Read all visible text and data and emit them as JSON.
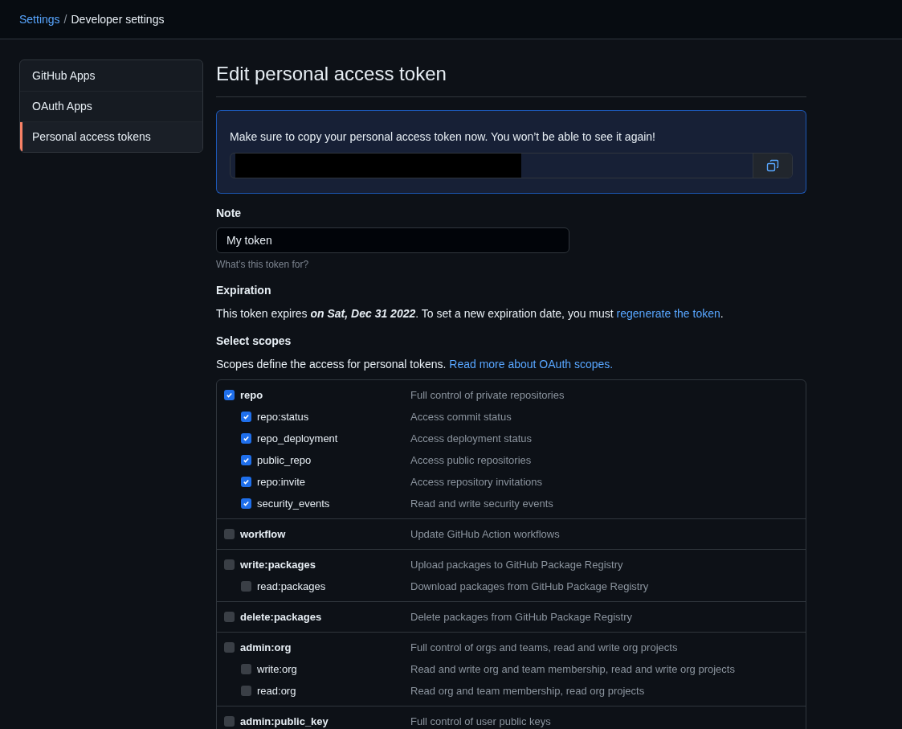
{
  "breadcrumb": {
    "link": "Settings",
    "separator": "/",
    "current": "Developer settings"
  },
  "sidebar": {
    "items": [
      {
        "label": "GitHub Apps",
        "selected": false
      },
      {
        "label": "OAuth Apps",
        "selected": false
      },
      {
        "label": "Personal access tokens",
        "selected": true
      }
    ]
  },
  "title": "Edit personal access token",
  "flash": {
    "message": "Make sure to copy your personal access token now. You won’t be able to see it again!"
  },
  "note": {
    "label": "Note",
    "value": "My token",
    "hint": "What’s this token for?"
  },
  "expiration": {
    "label": "Expiration",
    "text_before": "This token expires ",
    "date": "on Sat, Dec 31 2022",
    "text_middle": ". To set a new expiration date, you must ",
    "link": "regenerate the token",
    "text_after": "."
  },
  "scopes": {
    "label": "Select scopes",
    "description": "Scopes define the access for personal tokens.",
    "link": "Read more about OAuth scopes.",
    "groups": [
      {
        "name": "repo",
        "description": "Full control of private repositories",
        "checked": true,
        "children": [
          {
            "name": "repo:status",
            "description": "Access commit status",
            "checked": true
          },
          {
            "name": "repo_deployment",
            "description": "Access deployment status",
            "checked": true
          },
          {
            "name": "public_repo",
            "description": "Access public repositories",
            "checked": true
          },
          {
            "name": "repo:invite",
            "description": "Access repository invitations",
            "checked": true
          },
          {
            "name": "security_events",
            "description": "Read and write security events",
            "checked": true
          }
        ]
      },
      {
        "name": "workflow",
        "description": "Update GitHub Action workflows",
        "checked": false
      },
      {
        "name": "write:packages",
        "description": "Upload packages to GitHub Package Registry",
        "checked": false,
        "children": [
          {
            "name": "read:packages",
            "description": "Download packages from GitHub Package Registry",
            "checked": false
          }
        ]
      },
      {
        "name": "delete:packages",
        "description": "Delete packages from GitHub Package Registry",
        "checked": false
      },
      {
        "name": "admin:org",
        "description": "Full control of orgs and teams, read and write org projects",
        "checked": false,
        "children": [
          {
            "name": "write:org",
            "description": "Read and write org and team membership, read and write org projects",
            "checked": false
          },
          {
            "name": "read:org",
            "description": "Read org and team membership, read org projects",
            "checked": false
          }
        ]
      },
      {
        "name": "admin:public_key",
        "description": "Full control of user public keys",
        "checked": false
      }
    ]
  }
}
